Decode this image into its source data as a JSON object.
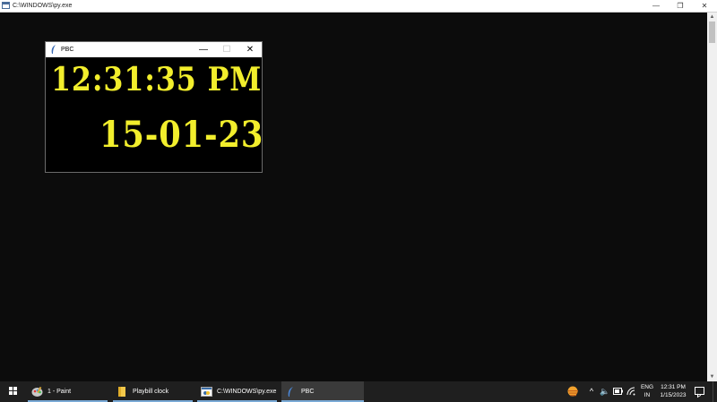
{
  "console": {
    "title": "C:\\WINDOWS\\py.exe",
    "controls": {
      "minimize": "—",
      "maximize": "❐",
      "close": "✕"
    }
  },
  "pbc": {
    "title": "PBC",
    "time": "12:31:35 PM",
    "date": "15-01-23",
    "controls": {
      "minimize": "—",
      "maximize": "☐",
      "close": "✕"
    },
    "text_color": "#f2ee2c",
    "background": "#000000"
  },
  "taskbar": {
    "items": [
      {
        "label": "1 - Paint",
        "icon": "paint-icon",
        "active": false
      },
      {
        "label": "Playbill clock",
        "icon": "folder-icon",
        "active": false
      },
      {
        "label": "C:\\WINDOWS\\py.exe",
        "icon": "python-console-icon",
        "active": false
      },
      {
        "label": "PBC",
        "icon": "feather-icon",
        "active": true
      }
    ],
    "tray": {
      "language_line1": "ENG",
      "language_line2": "IN",
      "time": "12:31 PM",
      "date": "1/15/2023"
    }
  }
}
